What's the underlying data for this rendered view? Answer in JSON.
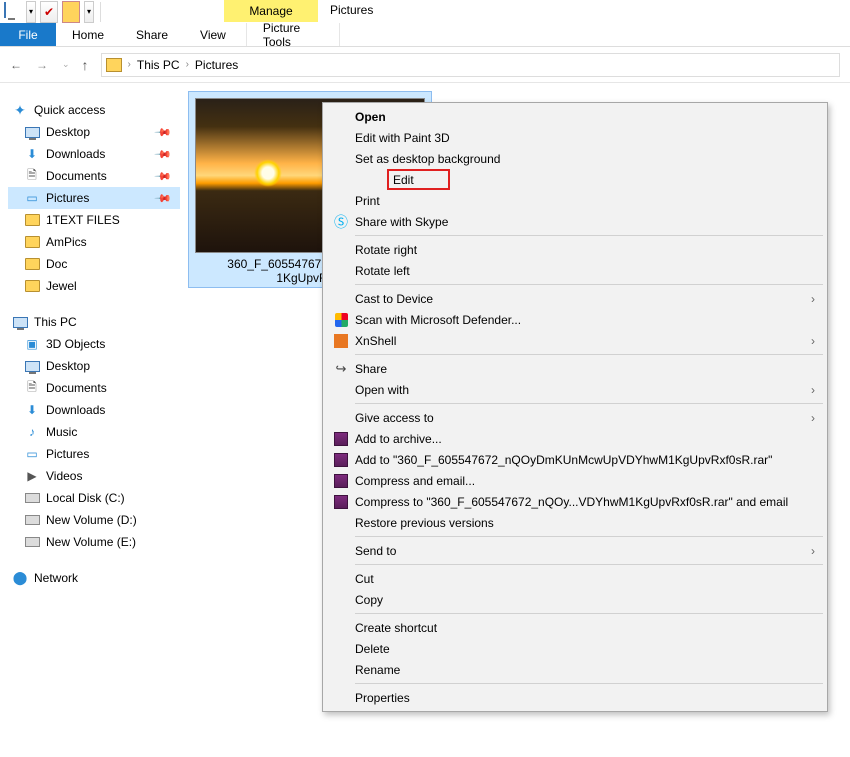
{
  "titlebar": {
    "manage": "Manage",
    "title": "Pictures"
  },
  "ribbon": {
    "file": "File",
    "home": "Home",
    "share": "Share",
    "view": "View",
    "tools": "Picture Tools"
  },
  "breadcrumb": {
    "root": "This PC",
    "current": "Pictures"
  },
  "sidebar": {
    "quick": "Quick access",
    "items": [
      {
        "label": "Desktop",
        "pinned": true
      },
      {
        "label": "Downloads",
        "pinned": true
      },
      {
        "label": "Documents",
        "pinned": true
      },
      {
        "label": "Pictures",
        "pinned": true,
        "selected": true
      },
      {
        "label": "1TEXT FILES"
      },
      {
        "label": "AmPics"
      },
      {
        "label": "Doc"
      },
      {
        "label": "Jewel"
      }
    ],
    "thispc": "This PC",
    "pc_items": [
      {
        "label": "3D Objects"
      },
      {
        "label": "Desktop"
      },
      {
        "label": "Documents"
      },
      {
        "label": "Downloads"
      },
      {
        "label": "Music"
      },
      {
        "label": "Pictures"
      },
      {
        "label": "Videos"
      },
      {
        "label": "Local Disk (C:)"
      },
      {
        "label": "New Volume (D:)"
      },
      {
        "label": "New Volume (E:)"
      }
    ],
    "network": "Network"
  },
  "thumb": {
    "line1": "360_F_605547672_nQOyDmK",
    "line2": "1KgUpvRxf0"
  },
  "ctx": {
    "open": "Open",
    "paint3d": "Edit with Paint 3D",
    "setbg": "Set as desktop background",
    "edit": "Edit",
    "print": "Print",
    "skype": "Share with Skype",
    "rot_r": "Rotate right",
    "rot_l": "Rotate left",
    "cast": "Cast to Device",
    "defender": "Scan with Microsoft Defender...",
    "xn": "XnShell",
    "share": "Share",
    "openwith": "Open with",
    "give": "Give access to",
    "addarc": "Add to archive...",
    "addrar": "Add to \"360_F_605547672_nQOyDmKUnMcwUpVDYhwM1KgUpvRxf0sR.rar\"",
    "cemail": "Compress and email...",
    "cemail2": "Compress to \"360_F_605547672_nQOy...VDYhwM1KgUpvRxf0sR.rar\" and email",
    "restore": "Restore previous versions",
    "sendto": "Send to",
    "cut": "Cut",
    "copy": "Copy",
    "shortcut": "Create shortcut",
    "delete": "Delete",
    "rename": "Rename",
    "props": "Properties"
  }
}
